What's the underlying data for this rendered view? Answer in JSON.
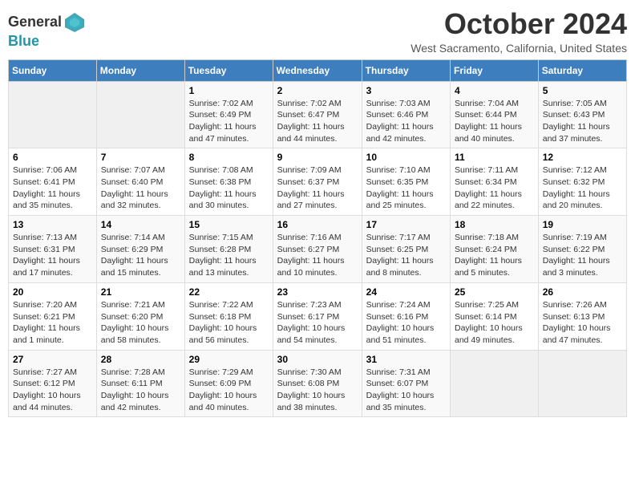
{
  "logo": {
    "line1": "General",
    "line2": "Blue"
  },
  "title": "October 2024",
  "subtitle": "West Sacramento, California, United States",
  "days_of_week": [
    "Sunday",
    "Monday",
    "Tuesday",
    "Wednesday",
    "Thursday",
    "Friday",
    "Saturday"
  ],
  "weeks": [
    [
      {
        "day": "",
        "sunrise": "",
        "sunset": "",
        "daylight": ""
      },
      {
        "day": "",
        "sunrise": "",
        "sunset": "",
        "daylight": ""
      },
      {
        "day": "1",
        "sunrise": "Sunrise: 7:02 AM",
        "sunset": "Sunset: 6:49 PM",
        "daylight": "Daylight: 11 hours and 47 minutes."
      },
      {
        "day": "2",
        "sunrise": "Sunrise: 7:02 AM",
        "sunset": "Sunset: 6:47 PM",
        "daylight": "Daylight: 11 hours and 44 minutes."
      },
      {
        "day": "3",
        "sunrise": "Sunrise: 7:03 AM",
        "sunset": "Sunset: 6:46 PM",
        "daylight": "Daylight: 11 hours and 42 minutes."
      },
      {
        "day": "4",
        "sunrise": "Sunrise: 7:04 AM",
        "sunset": "Sunset: 6:44 PM",
        "daylight": "Daylight: 11 hours and 40 minutes."
      },
      {
        "day": "5",
        "sunrise": "Sunrise: 7:05 AM",
        "sunset": "Sunset: 6:43 PM",
        "daylight": "Daylight: 11 hours and 37 minutes."
      }
    ],
    [
      {
        "day": "6",
        "sunrise": "Sunrise: 7:06 AM",
        "sunset": "Sunset: 6:41 PM",
        "daylight": "Daylight: 11 hours and 35 minutes."
      },
      {
        "day": "7",
        "sunrise": "Sunrise: 7:07 AM",
        "sunset": "Sunset: 6:40 PM",
        "daylight": "Daylight: 11 hours and 32 minutes."
      },
      {
        "day": "8",
        "sunrise": "Sunrise: 7:08 AM",
        "sunset": "Sunset: 6:38 PM",
        "daylight": "Daylight: 11 hours and 30 minutes."
      },
      {
        "day": "9",
        "sunrise": "Sunrise: 7:09 AM",
        "sunset": "Sunset: 6:37 PM",
        "daylight": "Daylight: 11 hours and 27 minutes."
      },
      {
        "day": "10",
        "sunrise": "Sunrise: 7:10 AM",
        "sunset": "Sunset: 6:35 PM",
        "daylight": "Daylight: 11 hours and 25 minutes."
      },
      {
        "day": "11",
        "sunrise": "Sunrise: 7:11 AM",
        "sunset": "Sunset: 6:34 PM",
        "daylight": "Daylight: 11 hours and 22 minutes."
      },
      {
        "day": "12",
        "sunrise": "Sunrise: 7:12 AM",
        "sunset": "Sunset: 6:32 PM",
        "daylight": "Daylight: 11 hours and 20 minutes."
      }
    ],
    [
      {
        "day": "13",
        "sunrise": "Sunrise: 7:13 AM",
        "sunset": "Sunset: 6:31 PM",
        "daylight": "Daylight: 11 hours and 17 minutes."
      },
      {
        "day": "14",
        "sunrise": "Sunrise: 7:14 AM",
        "sunset": "Sunset: 6:29 PM",
        "daylight": "Daylight: 11 hours and 15 minutes."
      },
      {
        "day": "15",
        "sunrise": "Sunrise: 7:15 AM",
        "sunset": "Sunset: 6:28 PM",
        "daylight": "Daylight: 11 hours and 13 minutes."
      },
      {
        "day": "16",
        "sunrise": "Sunrise: 7:16 AM",
        "sunset": "Sunset: 6:27 PM",
        "daylight": "Daylight: 11 hours and 10 minutes."
      },
      {
        "day": "17",
        "sunrise": "Sunrise: 7:17 AM",
        "sunset": "Sunset: 6:25 PM",
        "daylight": "Daylight: 11 hours and 8 minutes."
      },
      {
        "day": "18",
        "sunrise": "Sunrise: 7:18 AM",
        "sunset": "Sunset: 6:24 PM",
        "daylight": "Daylight: 11 hours and 5 minutes."
      },
      {
        "day": "19",
        "sunrise": "Sunrise: 7:19 AM",
        "sunset": "Sunset: 6:22 PM",
        "daylight": "Daylight: 11 hours and 3 minutes."
      }
    ],
    [
      {
        "day": "20",
        "sunrise": "Sunrise: 7:20 AM",
        "sunset": "Sunset: 6:21 PM",
        "daylight": "Daylight: 11 hours and 1 minute."
      },
      {
        "day": "21",
        "sunrise": "Sunrise: 7:21 AM",
        "sunset": "Sunset: 6:20 PM",
        "daylight": "Daylight: 10 hours and 58 minutes."
      },
      {
        "day": "22",
        "sunrise": "Sunrise: 7:22 AM",
        "sunset": "Sunset: 6:18 PM",
        "daylight": "Daylight: 10 hours and 56 minutes."
      },
      {
        "day": "23",
        "sunrise": "Sunrise: 7:23 AM",
        "sunset": "Sunset: 6:17 PM",
        "daylight": "Daylight: 10 hours and 54 minutes."
      },
      {
        "day": "24",
        "sunrise": "Sunrise: 7:24 AM",
        "sunset": "Sunset: 6:16 PM",
        "daylight": "Daylight: 10 hours and 51 minutes."
      },
      {
        "day": "25",
        "sunrise": "Sunrise: 7:25 AM",
        "sunset": "Sunset: 6:14 PM",
        "daylight": "Daylight: 10 hours and 49 minutes."
      },
      {
        "day": "26",
        "sunrise": "Sunrise: 7:26 AM",
        "sunset": "Sunset: 6:13 PM",
        "daylight": "Daylight: 10 hours and 47 minutes."
      }
    ],
    [
      {
        "day": "27",
        "sunrise": "Sunrise: 7:27 AM",
        "sunset": "Sunset: 6:12 PM",
        "daylight": "Daylight: 10 hours and 44 minutes."
      },
      {
        "day": "28",
        "sunrise": "Sunrise: 7:28 AM",
        "sunset": "Sunset: 6:11 PM",
        "daylight": "Daylight: 10 hours and 42 minutes."
      },
      {
        "day": "29",
        "sunrise": "Sunrise: 7:29 AM",
        "sunset": "Sunset: 6:09 PM",
        "daylight": "Daylight: 10 hours and 40 minutes."
      },
      {
        "day": "30",
        "sunrise": "Sunrise: 7:30 AM",
        "sunset": "Sunset: 6:08 PM",
        "daylight": "Daylight: 10 hours and 38 minutes."
      },
      {
        "day": "31",
        "sunrise": "Sunrise: 7:31 AM",
        "sunset": "Sunset: 6:07 PM",
        "daylight": "Daylight: 10 hours and 35 minutes."
      },
      {
        "day": "",
        "sunrise": "",
        "sunset": "",
        "daylight": ""
      },
      {
        "day": "",
        "sunrise": "",
        "sunset": "",
        "daylight": ""
      }
    ]
  ]
}
